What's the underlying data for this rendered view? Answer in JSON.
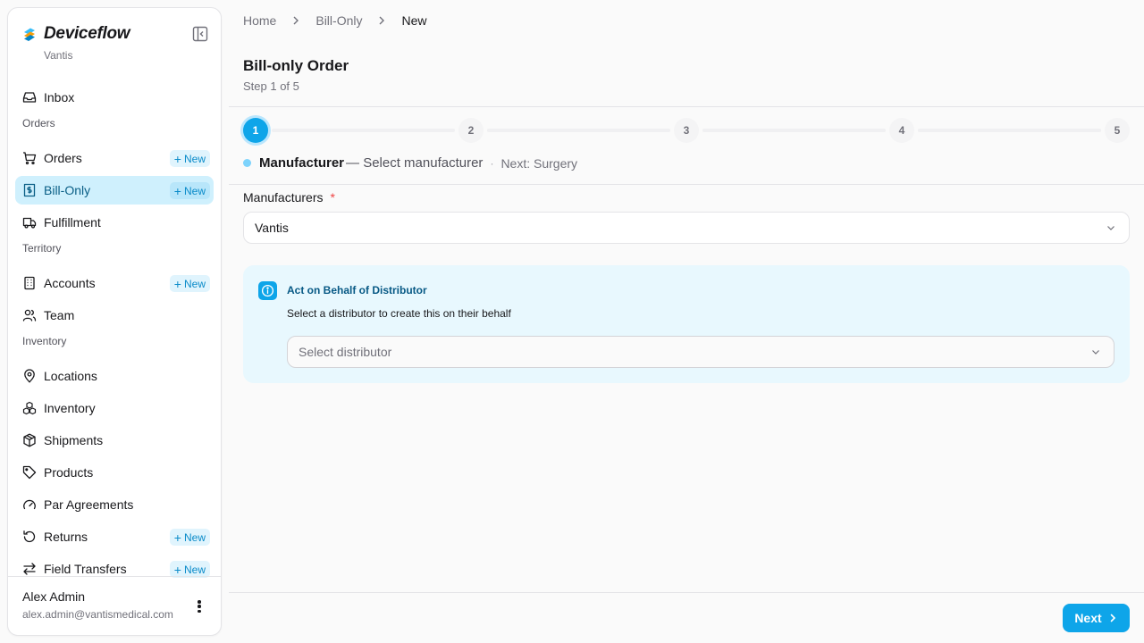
{
  "brand": {
    "name": "Deviceflow",
    "org": "Vantis"
  },
  "sidebar": {
    "items": [
      {
        "label": "Inbox"
      },
      {
        "label": "Orders",
        "badge": "New"
      },
      {
        "label": "Bill-Only",
        "badge": "New",
        "active": true
      },
      {
        "label": "Fulfillment"
      },
      {
        "label": "Accounts",
        "badge": "New"
      },
      {
        "label": "Team"
      },
      {
        "label": "Locations"
      },
      {
        "label": "Inventory"
      },
      {
        "label": "Shipments"
      },
      {
        "label": "Products"
      },
      {
        "label": "Par Agreements"
      },
      {
        "label": "Returns",
        "badge": "New"
      },
      {
        "label": "Field Transfers",
        "badge": "New"
      }
    ],
    "sections": [
      "Orders",
      "Territory",
      "Inventory"
    ],
    "user": {
      "name": "Alex Admin",
      "email": "alex.admin@vantismedical.com"
    }
  },
  "breadcrumb": [
    "Home",
    "Bill-Only",
    "New"
  ],
  "page": {
    "title": "Bill-only Order",
    "subtitle": "Step 1 of 5"
  },
  "stepper": {
    "steps": [
      "1",
      "2",
      "3",
      "4",
      "5"
    ],
    "current_step": 1,
    "current_name": "Manufacturer",
    "current_desc": "— Select manufacturer",
    "separator": "·",
    "next": "Next: Surgery"
  },
  "form": {
    "manufacturers_label": "Manufacturers",
    "required_mark": "*",
    "manufacturers_value": "Vantis",
    "callout": {
      "title": "Act on Behalf of Distributor",
      "text": "Select a distributor to create this on their behalf",
      "placeholder": "Select distributor"
    }
  },
  "footer": {
    "next_label": "Next"
  },
  "colors": {
    "accent": "#0ea5e9",
    "active_bg": "#cff0fd",
    "callout_bg": "#e8f8fe"
  }
}
